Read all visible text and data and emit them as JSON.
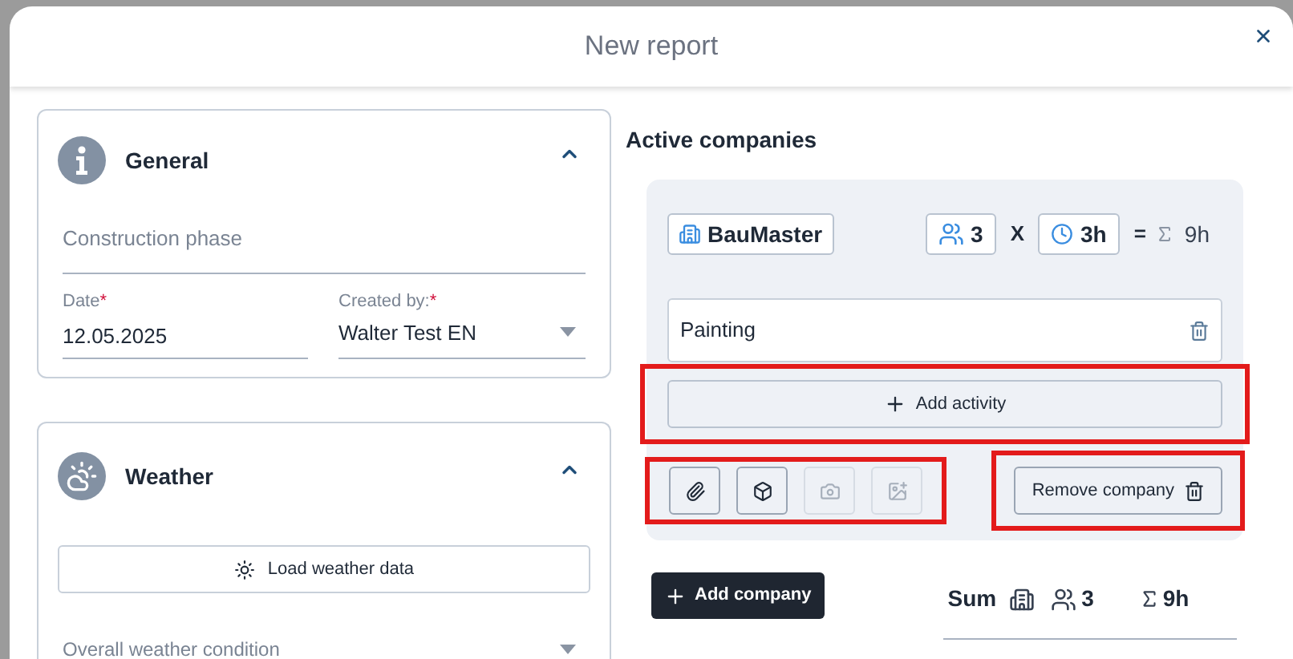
{
  "window": {
    "title": "New report"
  },
  "general": {
    "title": "General",
    "expanded": true,
    "construction_phase": {
      "placeholder": "Construction phase"
    },
    "date": {
      "label": "Date",
      "required_mark": "*",
      "value": "12.05.2025"
    },
    "created_by": {
      "label": "Created by:",
      "required_mark": "*",
      "value": "Walter Test EN"
    }
  },
  "weather": {
    "title": "Weather",
    "expanded": true,
    "load_button": "Load weather data",
    "condition": {
      "placeholder": "Overall weather condition"
    }
  },
  "active_companies": {
    "title": "Active companies",
    "companies": [
      {
        "name": "BauMaster",
        "workers": "3",
        "operator": "X",
        "hours": "3h",
        "equals": "=",
        "total": "9h",
        "activities": [
          {
            "name": "Painting"
          }
        ],
        "add_activity": "Add activity",
        "add_activity_highlighted": true,
        "tools": [
          {
            "kind": "attach",
            "disabled": false
          },
          {
            "kind": "model",
            "disabled": false
          },
          {
            "kind": "camera",
            "disabled": true
          },
          {
            "kind": "add_photo",
            "disabled": true
          }
        ],
        "tools_highlighted": true,
        "remove_button": "Remove company",
        "remove_highlighted": true
      }
    ],
    "add_company": "Add company",
    "sum": {
      "label": "Sum",
      "workers": "3",
      "total": "9h"
    }
  }
}
